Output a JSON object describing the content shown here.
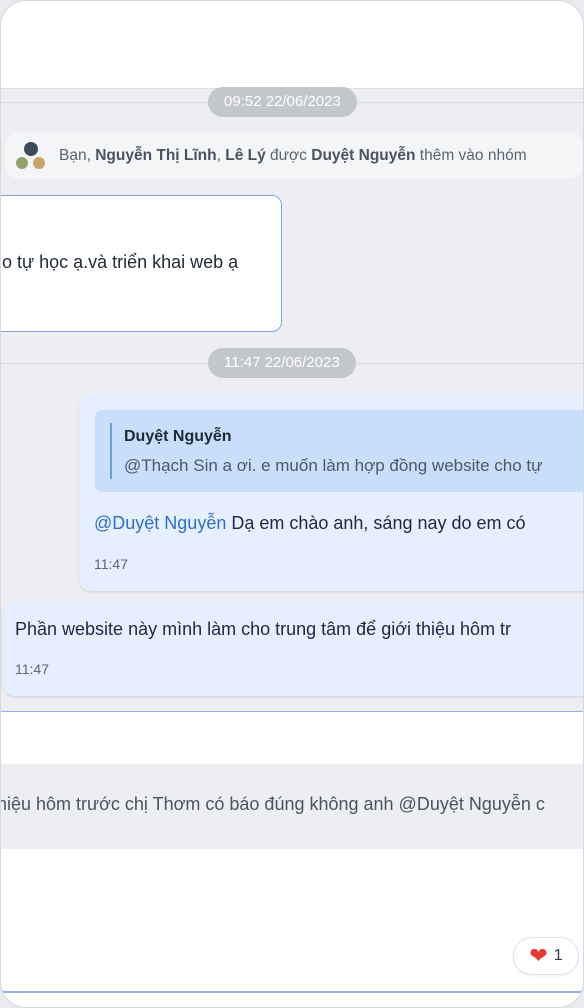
{
  "dividers": [
    {
      "time": "09:52 22/06/2023"
    },
    {
      "time": "11:47 22/06/2023"
    }
  ],
  "system_message": {
    "prefix": "Bạn, ",
    "member1": "Nguyễn Thị Lĩnh",
    "sep": ", ",
    "member2": "Lê Lý",
    "mid": " được ",
    "actor": "Duyệt Nguyễn",
    "suffix": " thêm vào nhóm"
  },
  "messages": [
    {
      "text": "o tự học ạ.và triển khai web ạ"
    },
    {
      "quote_name": "Duyệt Nguyễn",
      "quote_text": "@Thạch Sin a ơi. e muốn làm hợp đồng website cho tự",
      "mention": "@Duyệt Nguyễn",
      "text": " Dạ em chào anh, sáng nay do em có",
      "time": "11:47"
    },
    {
      "text": "Phần website này mình làm cho trung tâm để giới thiệu hôm tr",
      "time": "11:47"
    }
  ],
  "preview": {
    "text": "hiệu hôm trước chị Thơm có báo đúng không anh @Duyệt Nguyễn c"
  },
  "reaction": {
    "icon": "heart-icon",
    "count": "1",
    "color": "#e53935"
  }
}
